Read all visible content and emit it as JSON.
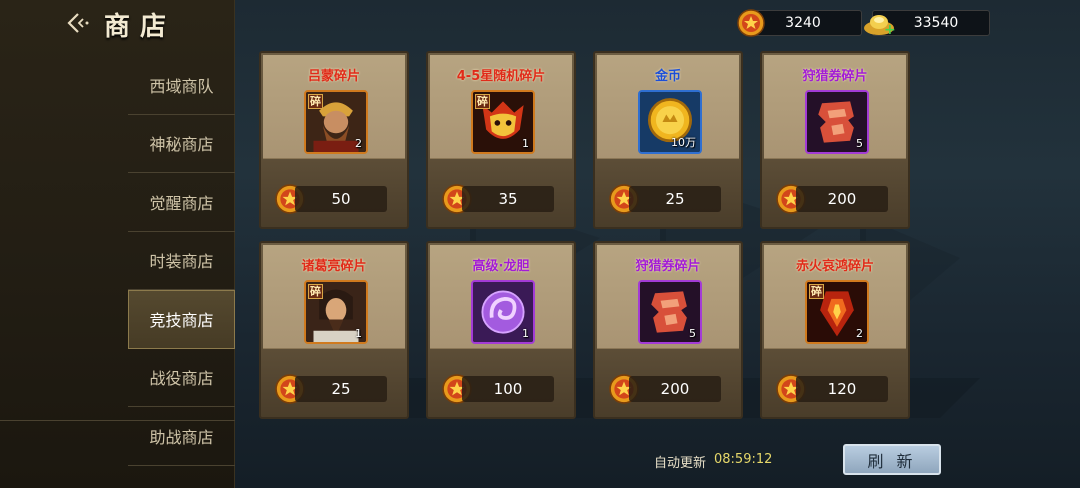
{
  "header": {
    "title": "商店",
    "back_icon": "back-chevron-icon"
  },
  "nav": {
    "items": [
      {
        "label": "西域商队",
        "active": false
      },
      {
        "label": "神秘商店",
        "active": false
      },
      {
        "label": "觉醒商店",
        "active": false
      },
      {
        "label": "时装商店",
        "active": false
      },
      {
        "label": "竞技商店",
        "active": true
      },
      {
        "label": "战役商店",
        "active": false
      },
      {
        "label": "助战商店",
        "active": false
      }
    ]
  },
  "currencies": {
    "medal": {
      "value": "3240",
      "icon": "arena-medal-icon"
    },
    "gold": {
      "value": "33540",
      "icon": "gold-ingot-icon",
      "add_icon": "plus-icon"
    }
  },
  "cards": [
    {
      "name": "吕蒙碎片",
      "badge": "碎",
      "qty": "2",
      "price": "50",
      "name_color": "#e02b1a"
    },
    {
      "name": "4-5星随机碎片",
      "badge": "碎",
      "qty": "1",
      "price": "35",
      "name_color": "#e02b1a"
    },
    {
      "name": "金币",
      "badge": "",
      "qty": "10万",
      "price": "25",
      "name_color": "#1c4fd8"
    },
    {
      "name": "狩猎券碎片",
      "badge": "",
      "qty": "5",
      "price": "200",
      "name_color": "#a21bd6"
    },
    {
      "name": "诸葛亮碎片",
      "badge": "碎",
      "qty": "1",
      "price": "25",
      "name_color": "#e02b1a"
    },
    {
      "name": "高级·龙胆",
      "badge": "",
      "qty": "1",
      "price": "100",
      "name_color": "#a21bd6"
    },
    {
      "name": "狩猎券碎片",
      "badge": "",
      "qty": "5",
      "price": "200",
      "name_color": "#a21bd6"
    },
    {
      "name": "赤火哀鸿碎片",
      "badge": "碎",
      "qty": "2",
      "price": "120",
      "name_color": "#e02b1a"
    }
  ],
  "footer": {
    "auto_refresh_label": "自动更新",
    "auto_refresh_time": "08:59:12",
    "refresh_button": "刷 新"
  }
}
